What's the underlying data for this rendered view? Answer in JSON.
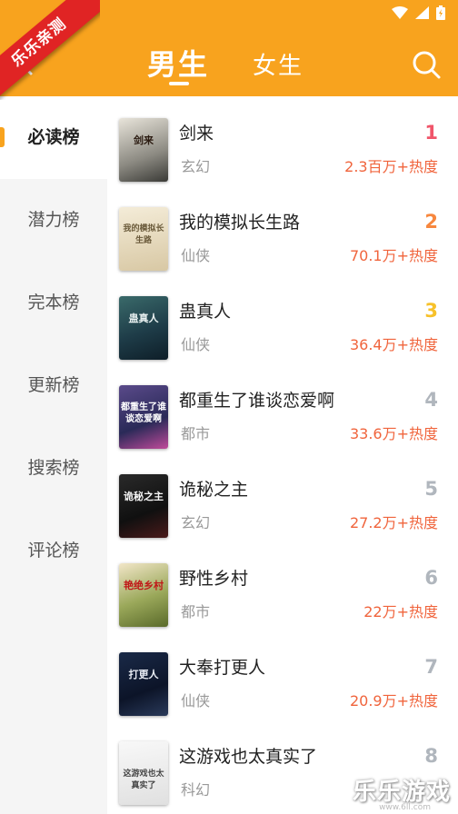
{
  "header": {
    "tab_male": "男生",
    "tab_female": "女生"
  },
  "ribbon": "乐乐亲测",
  "sidebar": {
    "items": [
      {
        "label": "必读榜",
        "active": true
      },
      {
        "label": "潜力榜"
      },
      {
        "label": "完本榜"
      },
      {
        "label": "更新榜"
      },
      {
        "label": "搜索榜"
      },
      {
        "label": "评论榜"
      }
    ]
  },
  "books": [
    {
      "rank": "1",
      "title": "剑来",
      "genre": "玄幻",
      "heat": "2.3百万+热度",
      "rank_color": "#f0556a",
      "cover_text": "剑来"
    },
    {
      "rank": "2",
      "title": "我的模拟长生路",
      "genre": "仙侠",
      "heat": "70.1万+热度",
      "rank_color": "#f7873e",
      "cover_text": "我的模拟长生路"
    },
    {
      "rank": "3",
      "title": "蛊真人",
      "genre": "仙侠",
      "heat": "36.4万+热度",
      "rank_color": "#f7c12a",
      "cover_text": "蛊真人"
    },
    {
      "rank": "4",
      "title": "都重生了谁谈恋爱啊",
      "genre": "都市",
      "heat": "33.6万+热度",
      "rank_color": "#b0b6bd",
      "cover_text": "都重生了谁谈恋爱啊"
    },
    {
      "rank": "5",
      "title": "诡秘之主",
      "genre": "玄幻",
      "heat": "27.2万+热度",
      "rank_color": "#b0b6bd",
      "cover_text": "诡秘之主"
    },
    {
      "rank": "6",
      "title": "野性乡村",
      "genre": "都市",
      "heat": "22万+热度",
      "rank_color": "#b0b6bd",
      "cover_text": "艳绝乡村"
    },
    {
      "rank": "7",
      "title": "大奉打更人",
      "genre": "仙侠",
      "heat": "20.9万+热度",
      "rank_color": "#b0b6bd",
      "cover_text": "打更人"
    },
    {
      "rank": "8",
      "title": "这游戏也太真实了",
      "genre": "科幻",
      "heat": "",
      "rank_color": "#b0b6bd",
      "cover_text": "这游戏也太真实了"
    }
  ],
  "watermark": {
    "text": "乐乐游戏",
    "url": "www.6ll.com"
  },
  "colors": {
    "brand": "#f8a31e",
    "heat": "#f0643c",
    "ribbon": "#e02424"
  }
}
